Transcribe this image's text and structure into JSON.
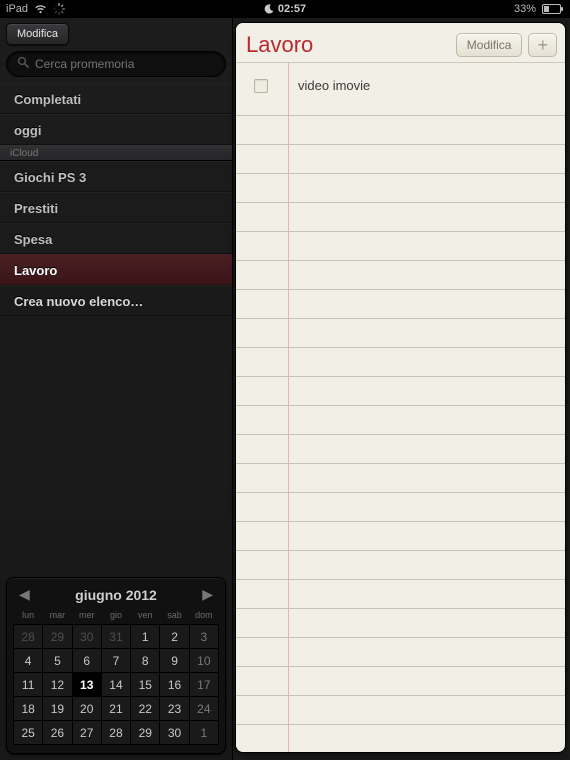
{
  "statusbar": {
    "carrier": "iPad",
    "dnd_icon": "moon-icon",
    "time": "02:57",
    "battery_text": "33%"
  },
  "sidebar": {
    "edit_button": "Modifica",
    "search_placeholder": "Cerca promemoria",
    "sections": [
      {
        "label": "Completati",
        "selected": false
      },
      {
        "label": "oggi",
        "selected": false
      }
    ],
    "account_header": "iCloud",
    "lists": [
      {
        "label": "Giochi PS 3",
        "selected": false
      },
      {
        "label": "Prestiti",
        "selected": false
      },
      {
        "label": "Spesa",
        "selected": false
      },
      {
        "label": "Lavoro",
        "selected": true
      },
      {
        "label": "Crea nuovo elenco…",
        "selected": false,
        "is_new": true
      }
    ]
  },
  "calendar": {
    "title": "giugno 2012",
    "weekdays": [
      "lun",
      "mar",
      "mer",
      "gio",
      "ven",
      "sab",
      "dom"
    ],
    "rows": [
      [
        {
          "d": "28",
          "other": true
        },
        {
          "d": "29",
          "other": true
        },
        {
          "d": "30",
          "other": true
        },
        {
          "d": "31",
          "other": true
        },
        {
          "d": "1"
        },
        {
          "d": "2"
        },
        {
          "d": "3",
          "sun": true
        }
      ],
      [
        {
          "d": "4"
        },
        {
          "d": "5"
        },
        {
          "d": "6"
        },
        {
          "d": "7"
        },
        {
          "d": "8"
        },
        {
          "d": "9"
        },
        {
          "d": "10",
          "sun": true
        }
      ],
      [
        {
          "d": "11"
        },
        {
          "d": "12"
        },
        {
          "d": "13",
          "today": true
        },
        {
          "d": "14"
        },
        {
          "d": "15"
        },
        {
          "d": "16"
        },
        {
          "d": "17",
          "sun": true
        }
      ],
      [
        {
          "d": "18"
        },
        {
          "d": "19"
        },
        {
          "d": "20"
        },
        {
          "d": "21"
        },
        {
          "d": "22"
        },
        {
          "d": "23"
        },
        {
          "d": "24",
          "sun": true
        }
      ],
      [
        {
          "d": "25"
        },
        {
          "d": "26"
        },
        {
          "d": "27"
        },
        {
          "d": "28"
        },
        {
          "d": "29"
        },
        {
          "d": "30"
        },
        {
          "d": "1",
          "other": true,
          "sun": true
        }
      ]
    ]
  },
  "detail": {
    "title": "Lavoro",
    "edit_button": "Modifica",
    "add_button": "+",
    "items": [
      {
        "text": "video imovie",
        "completed": false
      }
    ]
  }
}
